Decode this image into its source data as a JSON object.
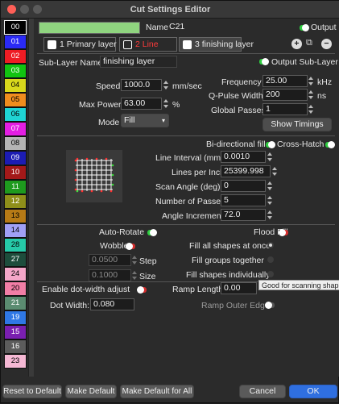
{
  "window": {
    "title": "Cut Settings Editor"
  },
  "colors": {
    "accent_green": "#8fd47f",
    "toggle_on": "#2ecc40",
    "toggle_red": "#d42d2d",
    "tab_red": "#ff3b3b"
  },
  "layers": [
    {
      "num": "00",
      "bg": "#000000",
      "fg": "#ffffff",
      "selected": true
    },
    {
      "num": "01",
      "bg": "#2a2af5",
      "fg": "#ffffff"
    },
    {
      "num": "02",
      "bg": "#ee1c24",
      "fg": "#ffffff"
    },
    {
      "num": "03",
      "bg": "#11c411",
      "fg": "#ffffff"
    },
    {
      "num": "04",
      "bg": "#d8d81c",
      "fg": "#000000"
    },
    {
      "num": "05",
      "bg": "#f08d1e",
      "fg": "#000000"
    },
    {
      "num": "06",
      "bg": "#1fd4d4",
      "fg": "#000000"
    },
    {
      "num": "07",
      "bg": "#e31ee3",
      "fg": "#ffffff"
    },
    {
      "num": "08",
      "bg": "#b4b4b4",
      "fg": "#000000"
    },
    {
      "num": "09",
      "bg": "#1c1cb3",
      "fg": "#ffffff"
    },
    {
      "num": "10",
      "bg": "#a31919",
      "fg": "#ffffff"
    },
    {
      "num": "11",
      "bg": "#1e9a1e",
      "fg": "#ffffff"
    },
    {
      "num": "12",
      "bg": "#8f8f1a",
      "fg": "#ffffff"
    },
    {
      "num": "13",
      "bg": "#b67a16",
      "fg": "#000000"
    },
    {
      "num": "14",
      "bg": "#a0a0f5",
      "fg": "#000000"
    },
    {
      "num": "28",
      "bg": "#26c9a8",
      "fg": "#000000"
    },
    {
      "num": "27",
      "bg": "#1d4d3c",
      "fg": "#ffffff"
    },
    {
      "num": "24",
      "bg": "#f4a6c8",
      "fg": "#000000"
    },
    {
      "num": "20",
      "bg": "#f27ea6",
      "fg": "#000000"
    },
    {
      "num": "21",
      "bg": "#5b8c71",
      "fg": "#ffffff"
    },
    {
      "num": "19",
      "bg": "#2f78e6",
      "fg": "#ffffff"
    },
    {
      "num": "15",
      "bg": "#7a1fb0",
      "fg": "#ffffff"
    },
    {
      "num": "16",
      "bg": "#5c5c5c",
      "fg": "#ffffff"
    },
    {
      "num": "23",
      "bg": "#f5b8d4",
      "fg": "#000000"
    }
  ],
  "header": {
    "name_label": "Name",
    "name_value": "C21",
    "output_label": "Output"
  },
  "tabs": [
    {
      "label": "1 Primary layer"
    },
    {
      "label": "2 Line"
    },
    {
      "label": "3 finishing layer"
    }
  ],
  "sublayer": {
    "name_label": "Sub-Layer Name",
    "name_value": "finishing layer",
    "output_label": "Output Sub-Layer"
  },
  "settings": {
    "speed_label": "Speed",
    "speed_value": "1000.0",
    "speed_unit": "mm/sec",
    "power_label": "Max Power",
    "power_value": "63.00",
    "power_unit": "%",
    "mode_label": "Mode",
    "mode_value": "Fill",
    "freq_label": "Frequency",
    "freq_value": "25.00",
    "freq_unit": "kHz",
    "qpulse_label": "Q-Pulse Width",
    "qpulse_value": "200",
    "qpulse_unit": "ns",
    "passes_label": "Global Passes",
    "passes_value": "1",
    "timings_button": "Show Timings"
  },
  "fill": {
    "bidir_label": "Bi-directional fill",
    "crosshatch_label": "Cross-Hatch",
    "interval_label": "Line Interval (mm)",
    "interval_value": "0.0010",
    "lpi_label": "Lines per Inch",
    "lpi_value": "25399.998",
    "angle_label": "Scan Angle (deg)",
    "angle_value": "0",
    "numpasses_label": "Number of Passes",
    "numpasses_value": "5",
    "increment_label": "Angle Increment",
    "increment_value": "72.0"
  },
  "options": {
    "autorotate_label": "Auto-Rotate",
    "wobble_label": "Wobble",
    "step_value": "0.0500",
    "step_label": "Step",
    "size_value": "0.1000",
    "size_label": "Size",
    "floodfill_label": "Flood Fill",
    "fillall_label": "Fill all shapes at once",
    "fillgroups_label": "Fill groups together",
    "fillindiv_label": "Fill shapes individually",
    "dotwidth_adjust_label": "Enable dot-width adjust",
    "dotwidth_label": "Dot Width:",
    "dotwidth_value": "0.080",
    "ramp_length_label": "Ramp Length",
    "ramp_length_value": "0.00",
    "ramp_outer_label": "Ramp Outer Edge"
  },
  "tooltip": {
    "text": "Good for scanning shapes"
  },
  "buttons": {
    "reset": "Reset to Default",
    "make_default": "Make Default",
    "make_default_all": "Make Default for All",
    "cancel": "Cancel",
    "ok": "OK"
  }
}
